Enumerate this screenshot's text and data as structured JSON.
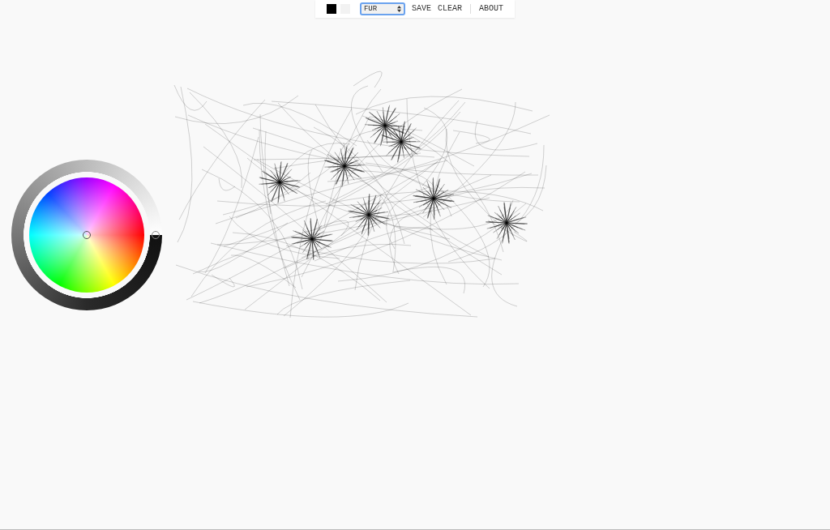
{
  "toolbar": {
    "swatches": [
      {
        "color": "#000000"
      },
      {
        "color": "#f2f2f2"
      }
    ],
    "brush_select": {
      "value": "FUR"
    },
    "buttons": [
      "SAVE",
      "CLEAR"
    ],
    "about": "ABOUT"
  }
}
